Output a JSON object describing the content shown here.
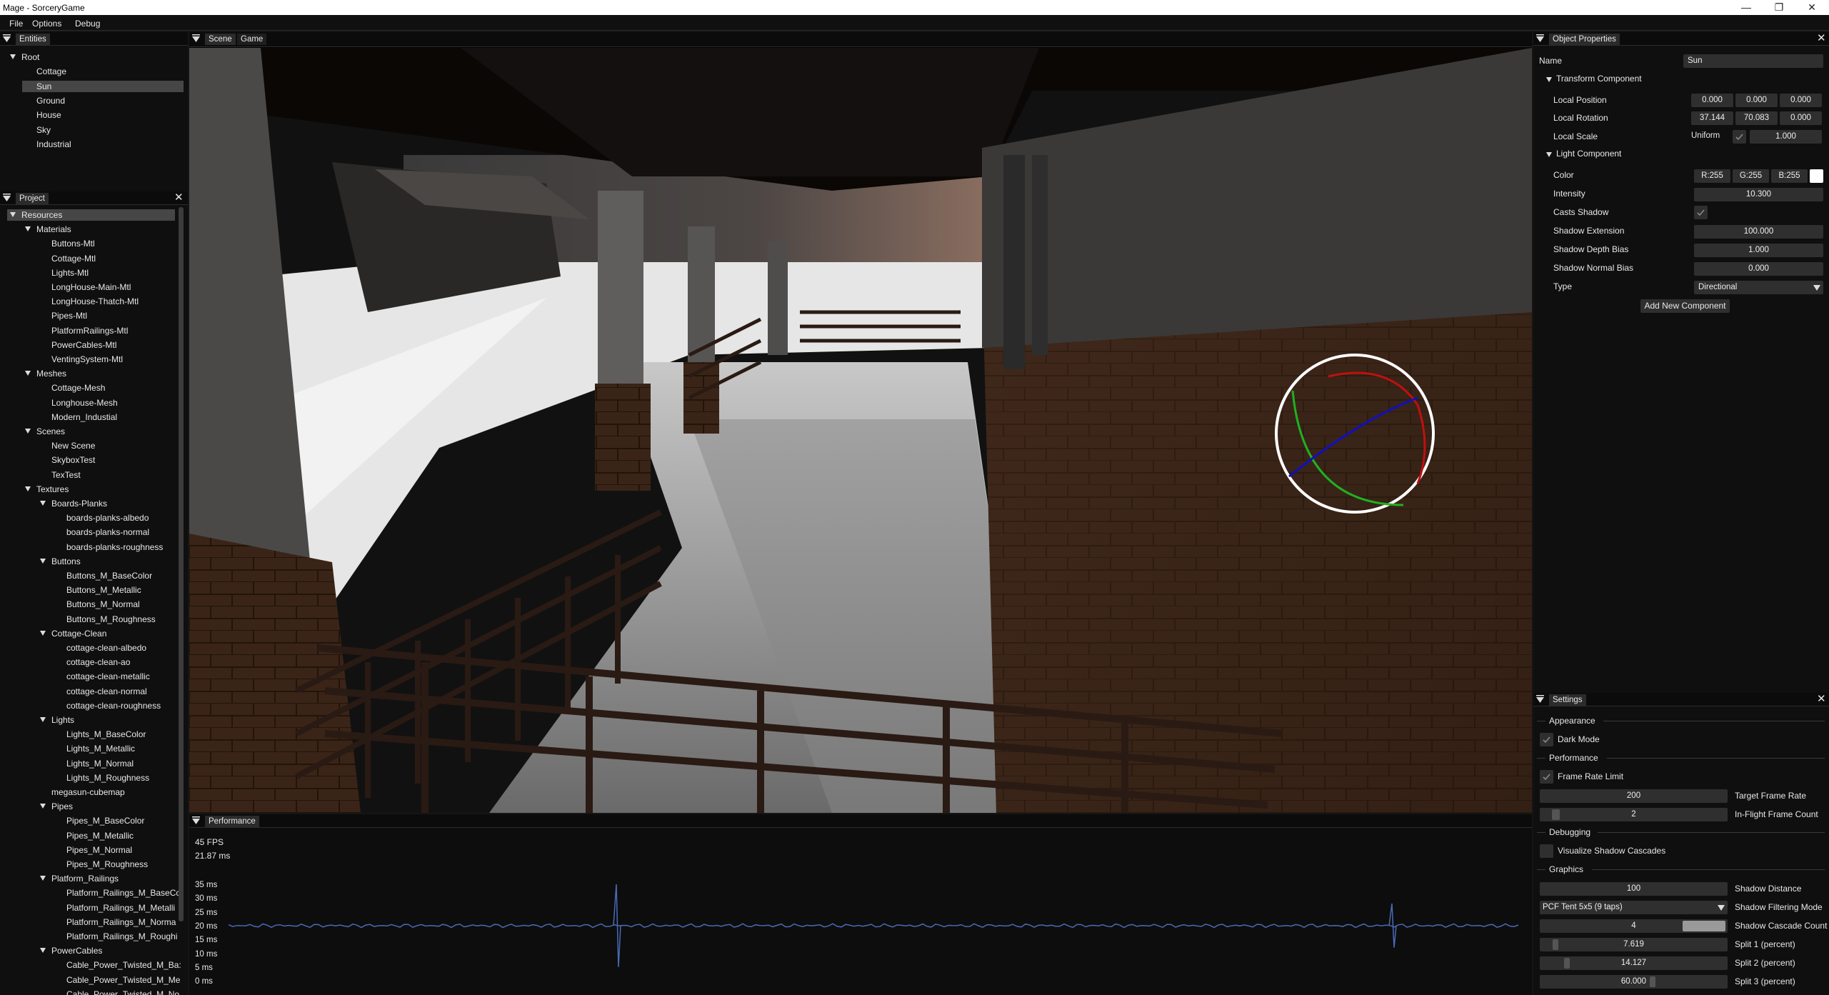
{
  "window": {
    "title": "Mage - SorceryGame",
    "min": "—",
    "max": "❐",
    "close": "✕"
  },
  "menu": [
    "File",
    "Options",
    "Debug"
  ],
  "entities": {
    "tab": "Entities",
    "items": [
      {
        "label": "Root",
        "depth": 0,
        "arrow": true
      },
      {
        "label": "Cottage",
        "depth": 1
      },
      {
        "label": "Sun",
        "depth": 1,
        "selected": true
      },
      {
        "label": "Ground",
        "depth": 1
      },
      {
        "label": "House",
        "depth": 1
      },
      {
        "label": "Sky",
        "depth": 1
      },
      {
        "label": "Industrial",
        "depth": 1
      }
    ]
  },
  "project": {
    "tab": "Project",
    "items": [
      {
        "label": "Resources",
        "depth": 0,
        "arrow": true,
        "selected": true
      },
      {
        "label": "Materials",
        "depth": 1,
        "arrow": true
      },
      {
        "label": "Buttons-Mtl",
        "depth": 2
      },
      {
        "label": "Cottage-Mtl",
        "depth": 2
      },
      {
        "label": "Lights-Mtl",
        "depth": 2
      },
      {
        "label": "LongHouse-Main-Mtl",
        "depth": 2
      },
      {
        "label": "LongHouse-Thatch-Mtl",
        "depth": 2
      },
      {
        "label": "Pipes-Mtl",
        "depth": 2
      },
      {
        "label": "PlatformRailings-Mtl",
        "depth": 2
      },
      {
        "label": "PowerCables-Mtl",
        "depth": 2
      },
      {
        "label": "VentingSystem-Mtl",
        "depth": 2
      },
      {
        "label": "Meshes",
        "depth": 1,
        "arrow": true
      },
      {
        "label": "Cottage-Mesh",
        "depth": 2
      },
      {
        "label": "Longhouse-Mesh",
        "depth": 2
      },
      {
        "label": "Modern_Industial",
        "depth": 2
      },
      {
        "label": "Scenes",
        "depth": 1,
        "arrow": true
      },
      {
        "label": "New Scene",
        "depth": 2
      },
      {
        "label": "SkyboxTest",
        "depth": 2
      },
      {
        "label": "TexTest",
        "depth": 2
      },
      {
        "label": "Textures",
        "depth": 1,
        "arrow": true
      },
      {
        "label": "Boards-Planks",
        "depth": 2,
        "arrow": true
      },
      {
        "label": "boards-planks-albedo",
        "depth": 3
      },
      {
        "label": "boards-planks-normal",
        "depth": 3
      },
      {
        "label": "boards-planks-roughness",
        "depth": 3
      },
      {
        "label": "Buttons",
        "depth": 2,
        "arrow": true
      },
      {
        "label": "Buttons_M_BaseColor",
        "depth": 3
      },
      {
        "label": "Buttons_M_Metallic",
        "depth": 3
      },
      {
        "label": "Buttons_M_Normal",
        "depth": 3
      },
      {
        "label": "Buttons_M_Roughness",
        "depth": 3
      },
      {
        "label": "Cottage-Clean",
        "depth": 2,
        "arrow": true
      },
      {
        "label": "cottage-clean-albedo",
        "depth": 3
      },
      {
        "label": "cottage-clean-ao",
        "depth": 3
      },
      {
        "label": "cottage-clean-metallic",
        "depth": 3
      },
      {
        "label": "cottage-clean-normal",
        "depth": 3
      },
      {
        "label": "cottage-clean-roughness",
        "depth": 3
      },
      {
        "label": "Lights",
        "depth": 2,
        "arrow": true
      },
      {
        "label": "Lights_M_BaseColor",
        "depth": 3
      },
      {
        "label": "Lights_M_Metallic",
        "depth": 3
      },
      {
        "label": "Lights_M_Normal",
        "depth": 3
      },
      {
        "label": "Lights_M_Roughness",
        "depth": 3
      },
      {
        "label": "megasun-cubemap",
        "depth": 2
      },
      {
        "label": "Pipes",
        "depth": 2,
        "arrow": true
      },
      {
        "label": "Pipes_M_BaseColor",
        "depth": 3
      },
      {
        "label": "Pipes_M_Metallic",
        "depth": 3
      },
      {
        "label": "Pipes_M_Normal",
        "depth": 3
      },
      {
        "label": "Pipes_M_Roughness",
        "depth": 3
      },
      {
        "label": "Platform_Railings",
        "depth": 2,
        "arrow": true
      },
      {
        "label": "Platform_Railings_M_BaseCc",
        "depth": 3
      },
      {
        "label": "Platform_Railings_M_Metalli",
        "depth": 3
      },
      {
        "label": "Platform_Railings_M_Norma",
        "depth": 3
      },
      {
        "label": "Platform_Railings_M_Roughi",
        "depth": 3
      },
      {
        "label": "PowerCables",
        "depth": 2,
        "arrow": true
      },
      {
        "label": "Cable_Power_Twisted_M_Ba:",
        "depth": 3
      },
      {
        "label": "Cable_Power_Twisted_M_Me",
        "depth": 3
      },
      {
        "label": "Cable_Power_Twisted_M_No",
        "depth": 3
      }
    ]
  },
  "viewport": {
    "tabs": [
      "Scene",
      "Game"
    ]
  },
  "performance": {
    "tab": "Performance",
    "fps": "45 FPS",
    "frame_ms": "21.87 ms",
    "y_ticks": [
      "35 ms",
      "30 ms",
      "25 ms",
      "20 ms",
      "15 ms",
      "10 ms",
      "5 ms",
      "0 ms"
    ],
    "baseline_ms": 20,
    "spikes": [
      {
        "at": 0.3,
        "value_ms": 35
      },
      {
        "at": 0.9,
        "value_ms": 28
      }
    ]
  },
  "properties": {
    "tab": "Object Properties",
    "name_label": "Name",
    "name_value": "Sun",
    "transform_header": "Transform Component",
    "local_position_label": "Local Position",
    "local_position": [
      "0.000",
      "0.000",
      "0.000"
    ],
    "local_rotation_label": "Local Rotation",
    "local_rotation": [
      "37.144",
      "70.083",
      "0.000"
    ],
    "local_scale_label": "Local Scale",
    "uniform_label": "Uniform",
    "uniform_checked": true,
    "local_scale": "1.000",
    "light_header": "Light Component",
    "color_label": "Color",
    "color": [
      "R:255",
      "G:255",
      "B:255"
    ],
    "color_swatch": "#ffffff",
    "intensity_label": "Intensity",
    "intensity": "10.300",
    "casts_shadow_label": "Casts Shadow",
    "casts_shadow": true,
    "shadow_extension_label": "Shadow Extension",
    "shadow_extension": "100.000",
    "shadow_depth_bias_label": "Shadow Depth Bias",
    "shadow_depth_bias": "1.000",
    "shadow_normal_bias_label": "Shadow Normal Bias",
    "shadow_normal_bias": "0.000",
    "type_label": "Type",
    "type_value": "Directional",
    "add_component": "Add New Component"
  },
  "settings": {
    "tab": "Settings",
    "appearance": "Appearance",
    "dark_mode": "Dark Mode",
    "dark_mode_checked": true,
    "performance": "Performance",
    "frame_rate_limit": "Frame Rate Limit",
    "frame_rate_limit_checked": true,
    "target_frame_rate_value": "200",
    "target_frame_rate": "Target Frame Rate",
    "in_flight_value": "2",
    "in_flight": "In-Flight Frame Count",
    "debugging": "Debugging",
    "visualize_cascades": "Visualize Shadow Cascades",
    "visualize_cascades_checked": false,
    "graphics": "Graphics",
    "shadow_distance_value": "100",
    "shadow_distance": "Shadow Distance",
    "filtering_value": "PCF Tent 5x5 (9 taps)",
    "filtering": "Shadow Filtering Mode",
    "cascade_count_value": "4",
    "cascade_count": "Shadow Cascade Count",
    "split1_value": "7.619",
    "split1": "Split 1 (percent)",
    "split2_value": "14.127",
    "split2": "Split 2 (percent)",
    "split3_value": "60.000",
    "split3": "Split 3 (percent)"
  }
}
